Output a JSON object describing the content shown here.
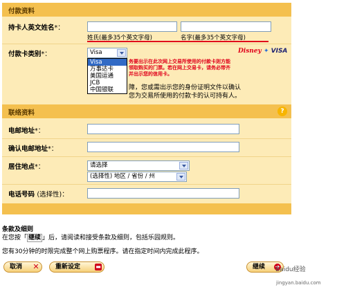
{
  "payment": {
    "section_title": "付款资料",
    "cardholder_label": "持卡人英文姓名",
    "req_mark": "*：",
    "last_name_hint": "姓氏(最多35个英文字母)",
    "first_name_hint": "名字(最多35个英文字母)",
    "card_type_label": "付款卡类别",
    "card_type_value": "Visa",
    "card_options": [
      "Visa",
      "万事达卡",
      "美国运通",
      "JCB",
      "中国银联"
    ],
    "red_notice": "务要出示在此次网上交易所使用的付款卡则方能领取购买的门票。若在网上交易卡，请务必带齐并出示您的信用卡。",
    "black_notice": "障，您或需出示您的身份证明文件以确认您为交易所使用的付款卡的认可持有人。",
    "logo_disney": "Disney",
    "logo_visa": "VISA"
  },
  "contact": {
    "section_title": "联络资料",
    "help": "?",
    "email_label": "电邮地址",
    "confirm_email_label": "确认电邮地址",
    "residence_label": "居住地点",
    "residence_value": "请选择",
    "region_value": "(选择性) 地区 / 省份 / 州",
    "phone_label": "电话号码",
    "phone_optional": "(选择性)",
    "colon": "：",
    "req_mark": "*："
  },
  "terms": {
    "title": "条款及细则",
    "text_before": "在您按「",
    "continue_word": "继续",
    "text_after": "」后，请阅读和接受条款及细则，包括乐园规则。",
    "time_notice": "您有30分钟的时限完成整个网上购票程序。请在指定时间内完成此程序。"
  },
  "buttons": {
    "cancel": "取消",
    "reset": "重新设定",
    "continue": "继续"
  },
  "watermark": {
    "main": "Baidu经验",
    "sub": "jingyan.baidu.com"
  }
}
